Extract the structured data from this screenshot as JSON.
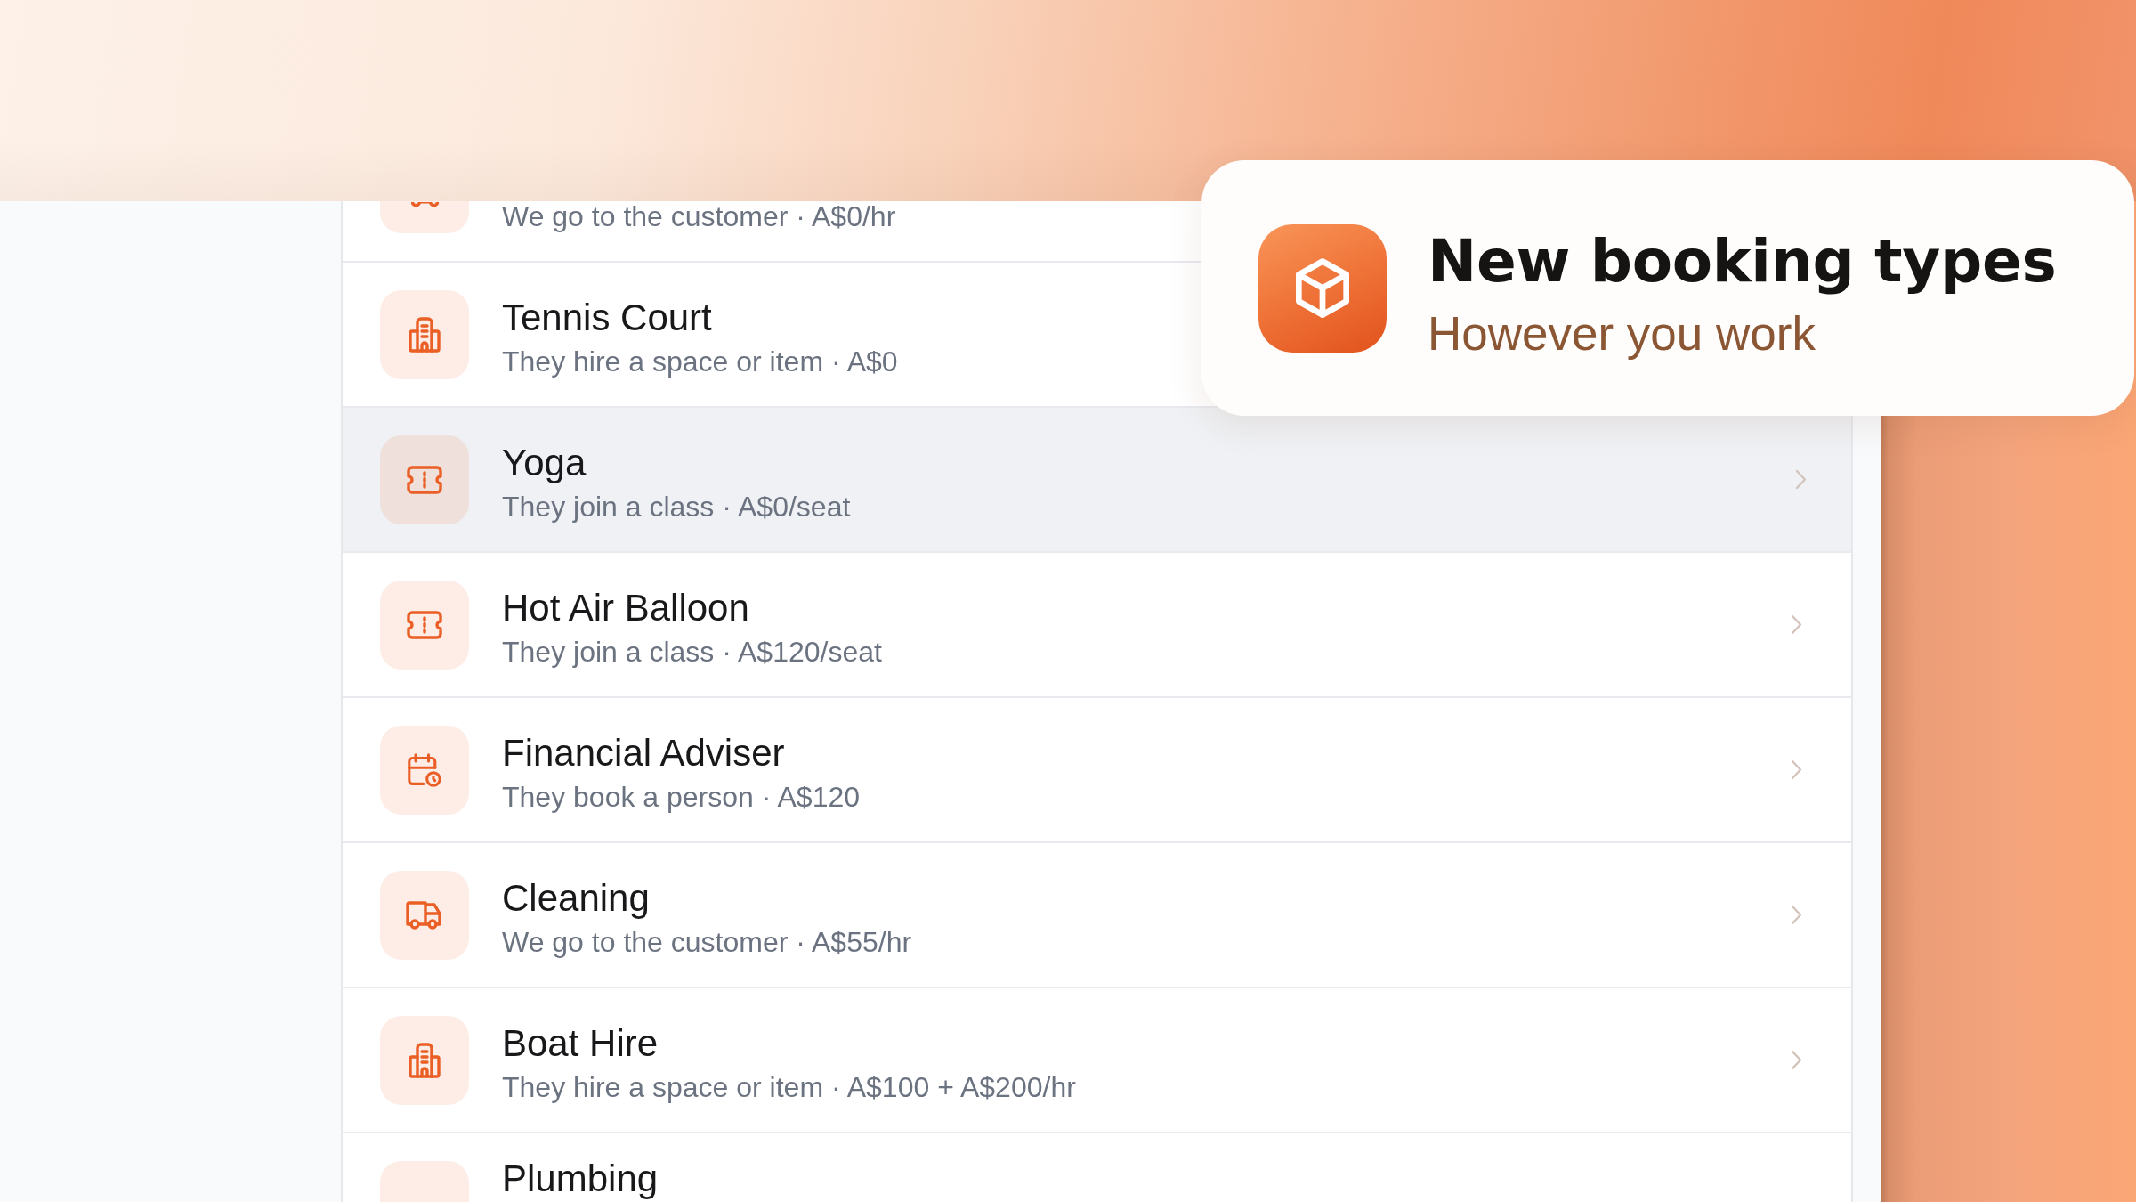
{
  "feature_card": {
    "title": "New booking types",
    "subtitle": "However you work"
  },
  "booking_types": [
    {
      "subtitle": "We go to the customer · A$0/hr",
      "kind": "mobile",
      "selected": false,
      "chevron": false
    },
    {
      "title": "Tennis Court",
      "subtitle": "They hire a space or item · A$0",
      "kind": "space",
      "selected": false,
      "chevron": false
    },
    {
      "title": "Yoga",
      "subtitle": "They join a class · A$0/seat",
      "kind": "class",
      "selected": true,
      "chevron": true
    },
    {
      "title": "Hot Air Balloon",
      "subtitle": "They join a class · A$120/seat",
      "kind": "class",
      "selected": false,
      "chevron": true
    },
    {
      "title": "Financial Adviser",
      "subtitle": "They book a person · A$120",
      "kind": "person",
      "selected": false,
      "chevron": true
    },
    {
      "title": "Cleaning",
      "subtitle": "We go to the customer · A$55/hr",
      "kind": "mobile",
      "selected": false,
      "chevron": true
    },
    {
      "title": "Boat Hire",
      "subtitle": "They hire a space or item · A$100 + A$200/hr",
      "kind": "space",
      "selected": false,
      "chevron": true
    },
    {
      "title": "Plumbing",
      "selected": false,
      "chevron": false
    }
  ]
}
